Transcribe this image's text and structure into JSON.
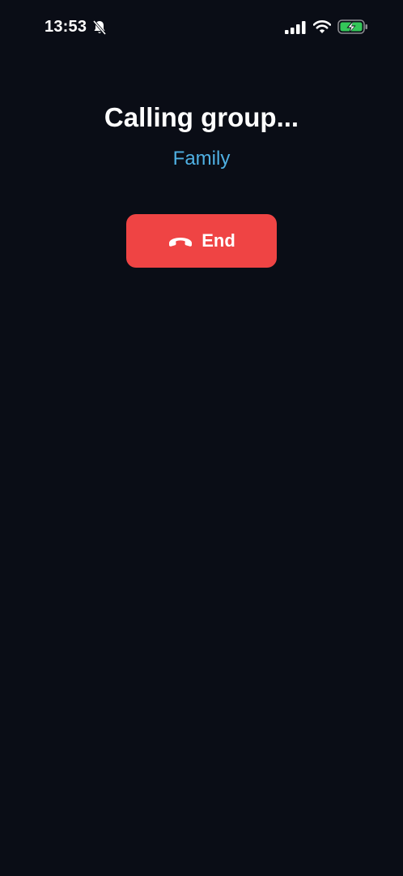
{
  "status_bar": {
    "time": "13:53",
    "icons": [
      "bell-slash-icon",
      "cellular-signal-icon",
      "wifi-icon",
      "battery-charging-icon"
    ],
    "battery_color": "#34c759"
  },
  "call": {
    "title": "Calling group...",
    "subtitle": "Family",
    "subtitle_color": "#4fb0e3"
  },
  "end_button": {
    "label": "End",
    "icon": "phone-hangup-icon",
    "color": "#ef4444"
  },
  "theme": {
    "background": "#0a0d16"
  }
}
